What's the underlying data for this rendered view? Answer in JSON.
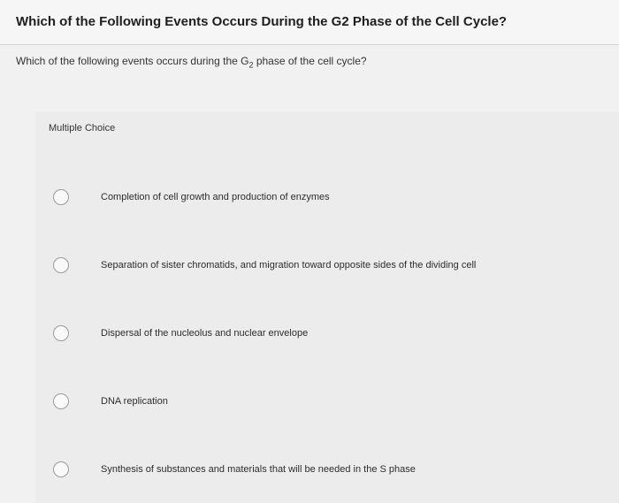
{
  "page": {
    "title": "Which of the Following Events Occurs During the G2 Phase of the Cell Cycle?"
  },
  "question": {
    "prefix": "Which of the following events occurs during the G",
    "subscript": "2",
    "suffix": " phase of the cell cycle?"
  },
  "choice_type": "Multiple Choice",
  "options": [
    {
      "label": "Completion of cell growth and production of enzymes"
    },
    {
      "label": "Separation of sister chromatids, and migration toward opposite sides of the dividing cell"
    },
    {
      "label": "Dispersal of the nucleolus and nuclear envelope"
    },
    {
      "label": "DNA replication"
    },
    {
      "label": "Synthesis of substances and materials that will be needed in the S phase"
    }
  ]
}
